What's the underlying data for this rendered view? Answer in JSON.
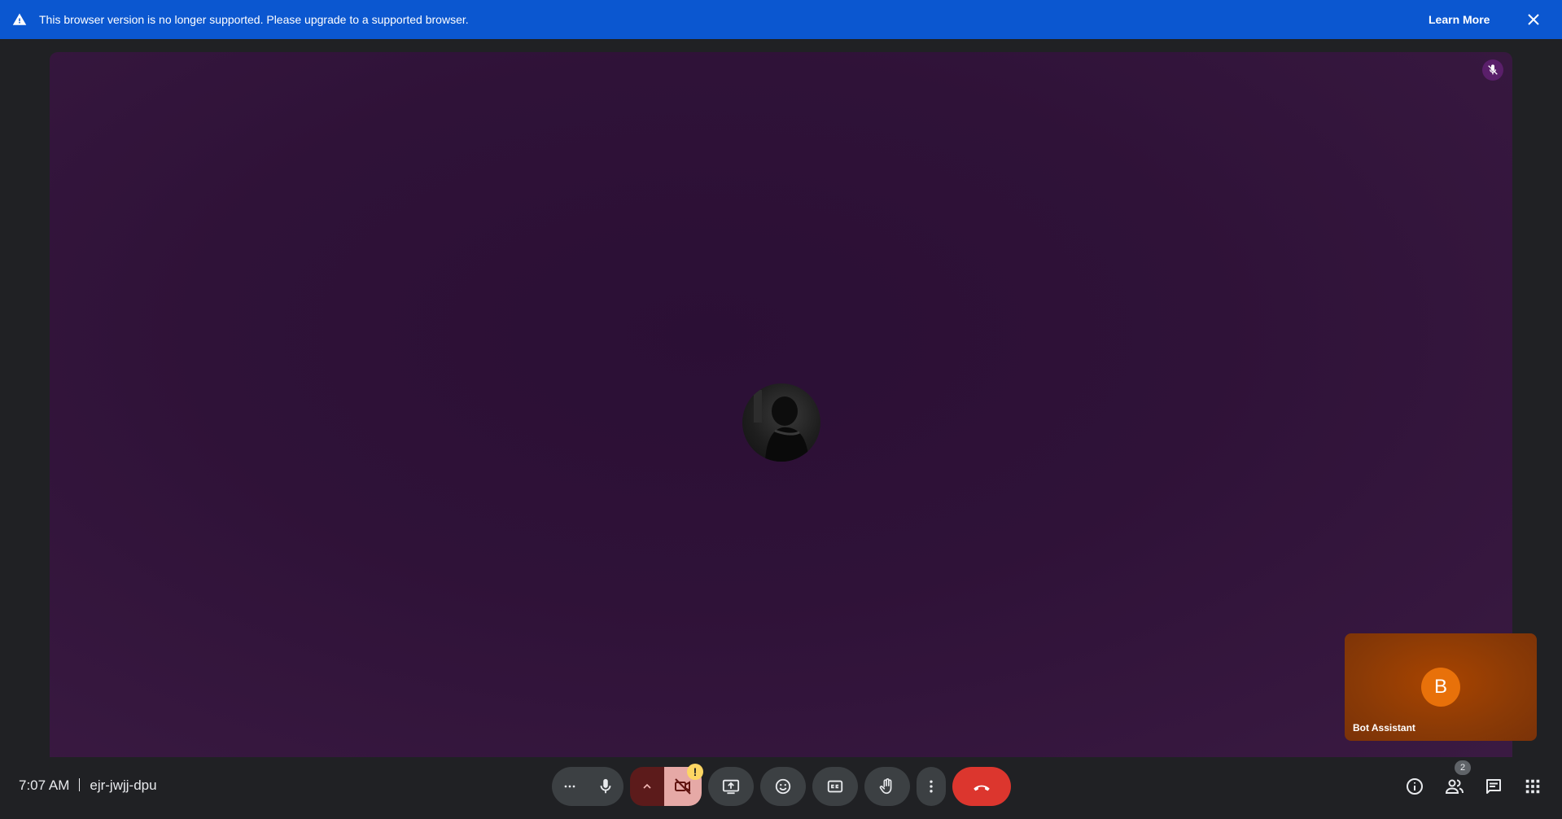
{
  "banner": {
    "message": "This browser version is no longer supported. Please upgrade to a supported browser.",
    "learn_more": "Learn More"
  },
  "self_tile": {
    "initial": "B",
    "name": "Bot Assistant"
  },
  "meeting": {
    "time": "7:07 AM",
    "code": "ejr-jwjj-dpu"
  },
  "people_count": "2",
  "camera_warning": "!",
  "colors": {
    "banner": "#0b57d0",
    "end_call": "#dc362e",
    "self_avatar": "#e8710a",
    "stage_bg": "#2f1238"
  }
}
